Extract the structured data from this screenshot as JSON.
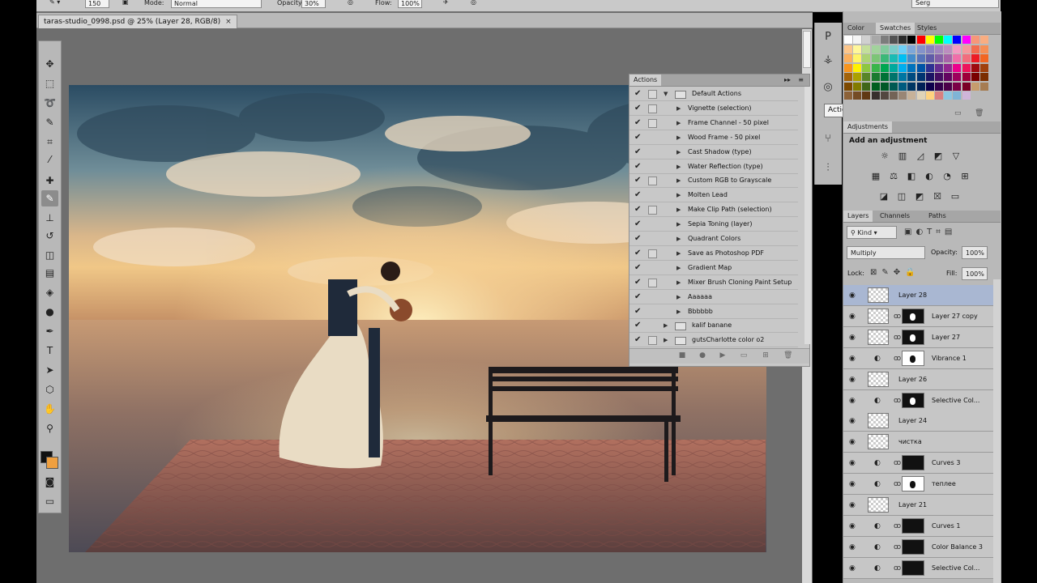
{
  "options_bar": {
    "brush_size": "150",
    "mode_label": "Mode:",
    "mode_value": "Normal",
    "opacity_label": "Opacity:",
    "opacity_value": "30%",
    "flow_label": "Flow:",
    "flow_value": "100%",
    "workspace_user": "Serg"
  },
  "document": {
    "tab_title": "taras-studio_0998.psd @ 25% (Layer 28, RGB/8)",
    "close_glyph": "×"
  },
  "tools": [
    {
      "name": "move-tool",
      "glyph": "✥"
    },
    {
      "name": "marquee-tool",
      "glyph": "⬚"
    },
    {
      "name": "lasso-tool",
      "glyph": "➰"
    },
    {
      "name": "quick-select-tool",
      "glyph": "✎"
    },
    {
      "name": "crop-tool",
      "glyph": "⌗"
    },
    {
      "name": "eyedropper-tool",
      "glyph": "⁄"
    },
    {
      "name": "healing-brush-tool",
      "glyph": "✚"
    },
    {
      "name": "brush-tool",
      "glyph": "✎"
    },
    {
      "name": "clone-stamp-tool",
      "glyph": "⊥"
    },
    {
      "name": "history-brush-tool",
      "glyph": "↺"
    },
    {
      "name": "eraser-tool",
      "glyph": "◫"
    },
    {
      "name": "gradient-tool",
      "glyph": "▤"
    },
    {
      "name": "blur-tool",
      "glyph": "◈"
    },
    {
      "name": "dodge-tool",
      "glyph": "●"
    },
    {
      "name": "pen-tool",
      "glyph": "✒"
    },
    {
      "name": "type-tool",
      "glyph": "T"
    },
    {
      "name": "path-select-tool",
      "glyph": "➤"
    },
    {
      "name": "shape-tool",
      "glyph": "⬡"
    },
    {
      "name": "hand-tool",
      "glyph": "✋"
    },
    {
      "name": "zoom-tool",
      "glyph": "⚲"
    }
  ],
  "actions_panel": {
    "tab_label": "Actions",
    "menu_glyph": "▸▸",
    "items": [
      {
        "label": "Default Actions",
        "level": 0,
        "kind": "set",
        "expanded": true,
        "dialog": true
      },
      {
        "label": "Vignette (selection)",
        "level": 1,
        "kind": "action",
        "dialog": true
      },
      {
        "label": "Frame Channel - 50 pixel",
        "level": 1,
        "kind": "action",
        "dialog": true
      },
      {
        "label": "Wood Frame - 50 pixel",
        "level": 1,
        "kind": "action",
        "dialog": false
      },
      {
        "label": "Cast Shadow (type)",
        "level": 1,
        "kind": "action",
        "dialog": false
      },
      {
        "label": "Water Reflection (type)",
        "level": 1,
        "kind": "action",
        "dialog": false
      },
      {
        "label": "Custom RGB to Grayscale",
        "level": 1,
        "kind": "action",
        "dialog": true
      },
      {
        "label": "Molten Lead",
        "level": 1,
        "kind": "action",
        "dialog": false
      },
      {
        "label": "Make Clip Path (selection)",
        "level": 1,
        "kind": "action",
        "dialog": true
      },
      {
        "label": "Sepia Toning (layer)",
        "level": 1,
        "kind": "action",
        "dialog": false
      },
      {
        "label": "Quadrant Colors",
        "level": 1,
        "kind": "action",
        "dialog": false
      },
      {
        "label": "Save as Photoshop PDF",
        "level": 1,
        "kind": "action",
        "dialog": true
      },
      {
        "label": "Gradient Map",
        "level": 1,
        "kind": "action",
        "dialog": false
      },
      {
        "label": "Mixer Brush Cloning Paint Setup",
        "level": 1,
        "kind": "action",
        "dialog": true
      },
      {
        "label": "Aaaaaa",
        "level": 1,
        "kind": "action",
        "dialog": false
      },
      {
        "label": "Bbbbbb",
        "level": 1,
        "kind": "action",
        "dialog": false
      },
      {
        "label": "kalif banane",
        "level": 0,
        "kind": "set",
        "expanded": false,
        "dialog": false
      },
      {
        "label": "gutsCharlotte color o2",
        "level": 0,
        "kind": "set",
        "expanded": false,
        "dialog": true
      }
    ],
    "footer_icons": [
      "stop-icon",
      "record-icon",
      "play-icon",
      "new-set-icon",
      "new-action-icon",
      "delete-icon"
    ]
  },
  "dock": {
    "tooltip": "Actions"
  },
  "swatches_panel": {
    "tabs": [
      "Color",
      "Swatches",
      "Styles"
    ],
    "active_tab": "Swatches",
    "colors": [
      "#ffffff",
      "#f4f4f4",
      "#d0d0d0",
      "#a8a8a8",
      "#7c7c7c",
      "#525252",
      "#2c2c2c",
      "#000000",
      "#ff0000",
      "#ffff00",
      "#00ff00",
      "#00ffff",
      "#0000ff",
      "#ff00ff",
      "#f7977a",
      "#f9ad81",
      "#fdc68a",
      "#fff79a",
      "#c4df9b",
      "#a2d39c",
      "#82ca9d",
      "#7bcdc8",
      "#6ecff6",
      "#7ea7d8",
      "#8493ca",
      "#8882be",
      "#a187be",
      "#bc8dbf",
      "#f49ac2",
      "#f6989d",
      "#f26c4f",
      "#f68e55",
      "#fbaf5c",
      "#fff467",
      "#acd372",
      "#7cc576",
      "#3bb878",
      "#1abbb4",
      "#00bff3",
      "#438ccb",
      "#5574b9",
      "#605ca8",
      "#855fa8",
      "#a763a8",
      "#f06ea9",
      "#f26d7d",
      "#ed1c24",
      "#f26522",
      "#f7941d",
      "#fff200",
      "#8dc73f",
      "#39b54a",
      "#00a651",
      "#00a99d",
      "#00aeef",
      "#0072bc",
      "#0054a6",
      "#2e3192",
      "#662d91",
      "#92278f",
      "#ec008c",
      "#ed145b",
      "#9e0b0f",
      "#a0410d",
      "#a36209",
      "#aba000",
      "#598527",
      "#1a7b30",
      "#007236",
      "#00746b",
      "#0076a3",
      "#004b80",
      "#003471",
      "#1b1464",
      "#440e62",
      "#630460",
      "#9e005d",
      "#9e0039",
      "#790000",
      "#7b2e00",
      "#7d4900",
      "#827b00",
      "#406618",
      "#005e20",
      "#005826",
      "#005952",
      "#005b7f",
      "#003663",
      "#002157",
      "#0d004c",
      "#32004b",
      "#4b0049",
      "#7b0046",
      "#7a0026",
      "#c69c6d",
      "#a67c52",
      "#8c6239",
      "#754c24",
      "#603913",
      "#362f2d",
      "#534741",
      "#736357",
      "#998675",
      "#c7b299",
      "#e0d3b8",
      "#ffd27f",
      "#d98080",
      "#8dc6e0",
      "#7fb4d6",
      "#cfb5d9"
    ]
  },
  "adjustments_panel": {
    "tab_label": "Adjustments",
    "title": "Add an adjustment",
    "icons": [
      [
        "brightness-icon",
        "levels-icon",
        "curves-icon",
        "exposure-icon",
        "vibrance-icon"
      ],
      [
        "hue-saturation-icon",
        "color-balance-icon",
        "black-white-icon",
        "photo-filter-icon",
        "channel-mixer-icon",
        "color-lookup-icon"
      ],
      [
        "invert-icon",
        "posterize-icon",
        "threshold-icon",
        "selective-color-icon",
        "gradient-map-icon"
      ]
    ]
  },
  "layers_panel": {
    "tabs": [
      "Layers",
      "Channels",
      "Paths"
    ],
    "active_tab": "Layers",
    "kind_filter": "Kind",
    "blend_mode": "Multiply",
    "opacity_label": "Opacity:",
    "opacity_value": "100%",
    "lock_label": "Lock:",
    "fill_label": "Fill:",
    "fill_value": "100%",
    "layers": [
      {
        "name": "Layer 28",
        "type": "pixel",
        "selected": true,
        "mask": false
      },
      {
        "name": "Layer 27 copy",
        "type": "pixel",
        "selected": false,
        "mask": true
      },
      {
        "name": "Layer 27",
        "type": "pixel",
        "selected": false,
        "mask": true
      },
      {
        "name": "Vibrance 1",
        "type": "adjustment",
        "selected": false,
        "mask": "white"
      },
      {
        "name": "Layer 26",
        "type": "pixel",
        "selected": false,
        "mask": false
      },
      {
        "name": "Selective Col...",
        "type": "adjustment",
        "selected": false,
        "mask": true
      },
      {
        "name": "Layer 24",
        "type": "pixel",
        "selected": false,
        "mask": false
      },
      {
        "name": "чистка",
        "type": "pixel",
        "selected": false,
        "mask": false
      },
      {
        "name": "Curves 3",
        "type": "adjustment",
        "selected": false,
        "mask": "black"
      },
      {
        "name": "теплее",
        "type": "adjustment",
        "selected": false,
        "mask": "white"
      },
      {
        "name": "Layer 21",
        "type": "pixel",
        "selected": false,
        "mask": false
      },
      {
        "name": "Curves 1",
        "type": "adjustment",
        "selected": false,
        "mask": "black"
      },
      {
        "name": "Color Balance 3",
        "type": "adjustment",
        "selected": false,
        "mask": "black"
      },
      {
        "name": "Selective Col...",
        "type": "adjustment",
        "selected": false,
        "mask": "black"
      }
    ]
  }
}
